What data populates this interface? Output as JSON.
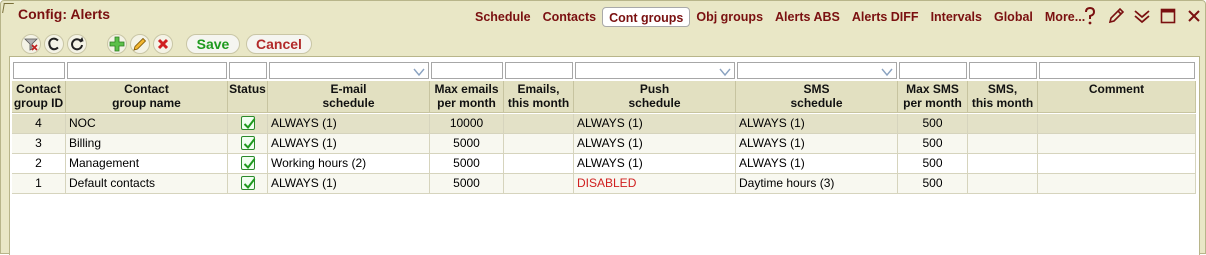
{
  "app": {
    "title": "Config: Alerts"
  },
  "nav": {
    "items": [
      {
        "label": "Schedule",
        "active": false
      },
      {
        "label": "Contacts",
        "active": false
      },
      {
        "label": "Cont groups",
        "active": true
      },
      {
        "label": "Obj groups",
        "active": false
      },
      {
        "label": "Alerts ABS",
        "active": false
      },
      {
        "label": "Alerts DIFF",
        "active": false
      },
      {
        "label": "Intervals",
        "active": false
      },
      {
        "label": "Global",
        "active": false
      },
      {
        "label": "More...",
        "active": false
      }
    ]
  },
  "window_icons": [
    "help-icon",
    "pencil-icon",
    "collapse-icon",
    "maximize-icon",
    "close-icon"
  ],
  "toolbar": {
    "save_label": "Save",
    "cancel_label": "Cancel",
    "icons": [
      "clear-filter-icon",
      "c-icon",
      "refresh-icon",
      "add-icon",
      "edit-icon",
      "delete-icon"
    ]
  },
  "table": {
    "columns": [
      {
        "key": "id",
        "label_line1": "Contact",
        "label_line2": "group ID",
        "filter": "text"
      },
      {
        "key": "name",
        "label_line1": "Contact",
        "label_line2": "group name",
        "filter": "text"
      },
      {
        "key": "status",
        "label_line1": "Status",
        "label_line2": "",
        "filter": "text"
      },
      {
        "key": "email_schedule",
        "label_line1": "E-mail",
        "label_line2": "schedule",
        "filter": "dropdown"
      },
      {
        "key": "max_emails",
        "label_line1": "Max emails",
        "label_line2": "per month",
        "filter": "text"
      },
      {
        "key": "emails_month",
        "label_line1": "Emails,",
        "label_line2": "this month",
        "filter": "text"
      },
      {
        "key": "push_schedule",
        "label_line1": "Push",
        "label_line2": "schedule",
        "filter": "dropdown"
      },
      {
        "key": "sms_schedule",
        "label_line1": "SMS",
        "label_line2": "schedule",
        "filter": "dropdown"
      },
      {
        "key": "max_sms",
        "label_line1": "Max SMS",
        "label_line2": "per month",
        "filter": "text"
      },
      {
        "key": "sms_month",
        "label_line1": "SMS,",
        "label_line2": "this month",
        "filter": "text"
      },
      {
        "key": "comment",
        "label_line1": "Comment",
        "label_line2": "",
        "filter": "text"
      }
    ],
    "rows": [
      {
        "id": "4",
        "name": "NOC",
        "status": true,
        "email_schedule": "ALWAYS (1)",
        "max_emails": "10000",
        "emails_month": "",
        "push_schedule": "ALWAYS (1)",
        "push_disabled": false,
        "sms_schedule": "ALWAYS (1)",
        "max_sms": "500",
        "sms_month": "",
        "comment": "",
        "selected": true
      },
      {
        "id": "3",
        "name": "Billing",
        "status": true,
        "email_schedule": "ALWAYS (1)",
        "max_emails": "5000",
        "emails_month": "",
        "push_schedule": "ALWAYS (1)",
        "push_disabled": false,
        "sms_schedule": "ALWAYS (1)",
        "max_sms": "500",
        "sms_month": "",
        "comment": "",
        "selected": false
      },
      {
        "id": "2",
        "name": "Management",
        "status": true,
        "email_schedule": "Working hours (2)",
        "max_emails": "5000",
        "emails_month": "",
        "push_schedule": "ALWAYS (1)",
        "push_disabled": false,
        "sms_schedule": "ALWAYS (1)",
        "max_sms": "500",
        "sms_month": "",
        "comment": "",
        "selected": false
      },
      {
        "id": "1",
        "name": "Default contacts",
        "status": true,
        "email_schedule": "ALWAYS (1)",
        "max_emails": "5000",
        "emails_month": "",
        "push_schedule": "DISABLED",
        "push_disabled": true,
        "sms_schedule": "Daytime hours (3)",
        "max_sms": "500",
        "sms_month": "",
        "comment": "",
        "selected": false
      }
    ]
  },
  "colors": {
    "title": "#7a1010",
    "disabled": "#d02020",
    "save": "#1e9a1e",
    "cancel": "#b22a2a",
    "header_bg": "#e2e0c1",
    "frame_bg": "#e9e7c6"
  }
}
